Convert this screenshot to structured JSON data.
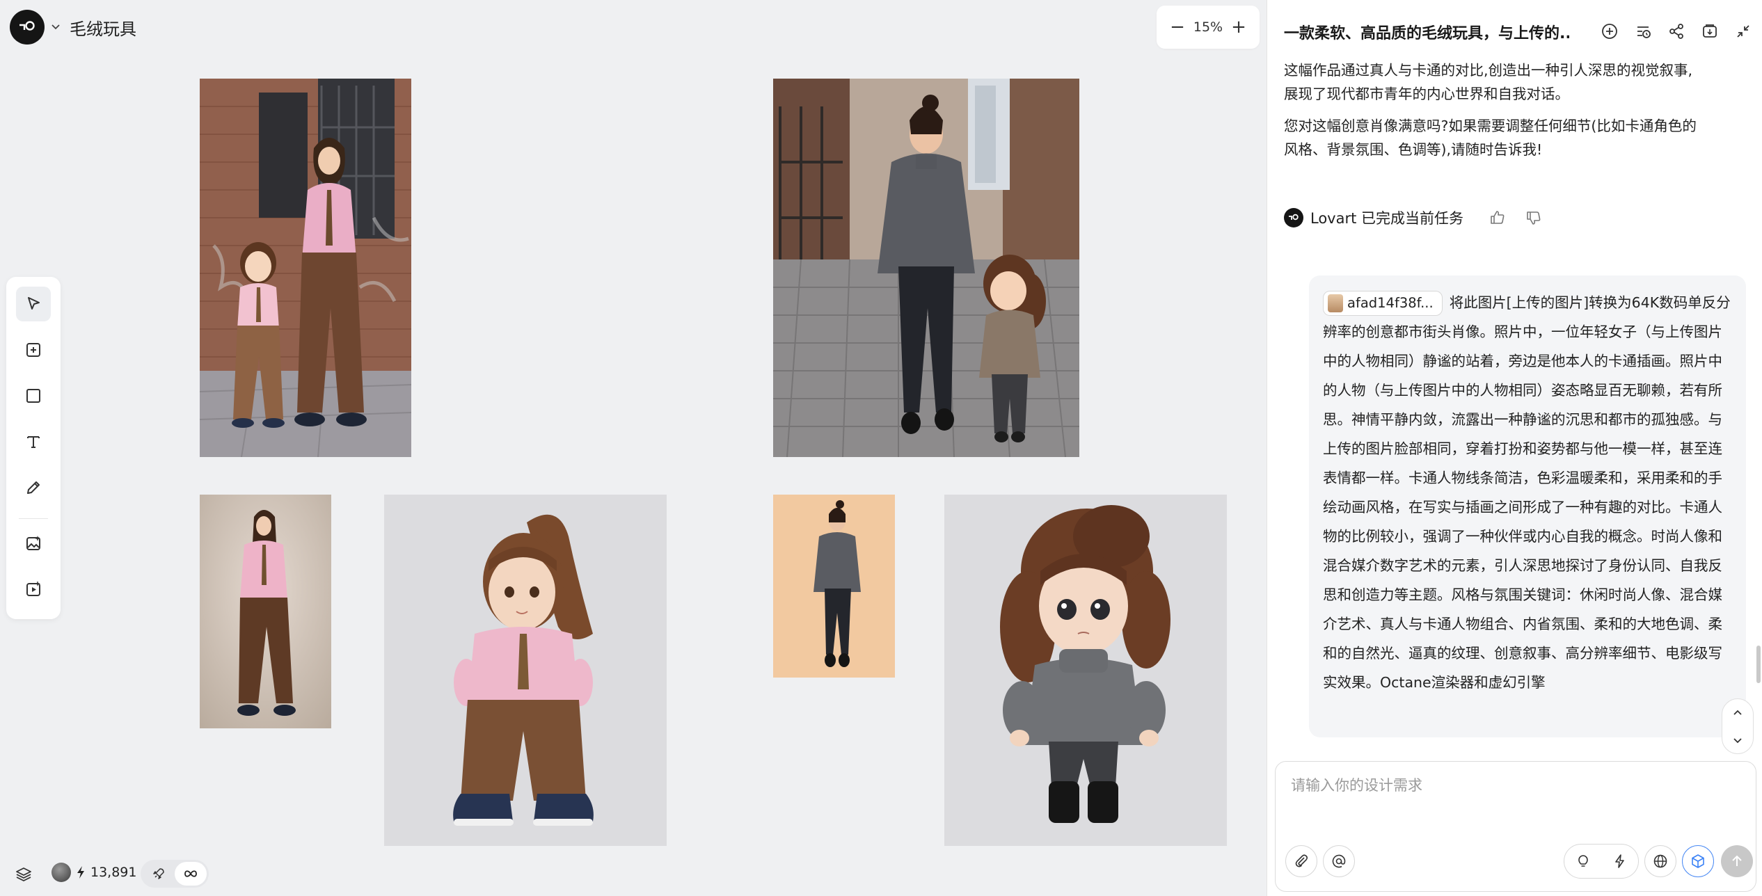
{
  "project": {
    "title": "毛绒玩具"
  },
  "zoom": {
    "minus": "−",
    "value": "15%",
    "plus": "+"
  },
  "tools": [
    "select-icon",
    "add-frame-icon",
    "rectangle-icon",
    "text-icon",
    "pencil-icon",
    "image-generate-icon",
    "video-generate-icon"
  ],
  "canvas_images": [
    {
      "name": "canvas-image-street-pink-shirt",
      "desc": "photo"
    },
    {
      "name": "canvas-image-street-grey-sweater",
      "desc": "photo"
    },
    {
      "name": "canvas-image-pink-shirt-fullbody",
      "desc": "photo"
    },
    {
      "name": "canvas-image-plush-doll-pink-shirt",
      "desc": "photo"
    },
    {
      "name": "canvas-image-grey-sweater-fullbody",
      "desc": "photo"
    },
    {
      "name": "canvas-image-plush-doll-grey-sweater",
      "desc": "photo"
    }
  ],
  "bottom_bar": {
    "credits": "13,891"
  },
  "panel": {
    "title": "一款柔软、高品质的毛绒玩具，与上传的...",
    "assistant_paragraphs": [
      "这幅作品通过真人与卡通的对比,创造出一种引人深思的视觉叙事,",
      "展现了现代都市青年的内心世界和自我对话。",
      "您对这幅创意肖像满意吗?如果需要调整任何细节(比如卡通角色的",
      "风格、背景氛围、色调等),请随时告诉我!"
    ],
    "done_text": "Lovart 已完成当前任务",
    "file_chip": "afad14f38f...",
    "user_message": "将此图片[上传的图片]转换为64K数码单反分辨率的创意都市街头肖像。照片中，一位年轻女子（与上传图片中的人物相同）静谧的站着，旁边是他本人的卡通插画。照片中的人物（与上传图片中的人物相同）姿态略显百无聊赖，若有所思。神情平静内敛，流露出一种静谧的沉思和都市的孤独感。与上传的图片脸部相同，穿着打扮和姿势都与他一模一样，甚至连表情都一样。卡通人物线条简洁，色彩温暖柔和，采用柔和的手绘动画风格，在写实与插画之间形成了一种有趣的对比。卡通人物的比例较小，强调了一种伙伴或内心自我的概念。时尚人像和混合媒介数字艺术的元素，引人深思地探讨了身份认同、自我反思和创造力等主题。风格与氛围关键词：休闲时尚人像、混合媒介艺术、真人与卡通人物组合、内省氛围、柔和的大地色调、柔和的自然光、逼真的纹理、创意叙事、高分辨率细节、电影级写实效果。Octane渲染器和虚幻引擎",
    "composer_placeholder": "请输入你的设计需求"
  }
}
